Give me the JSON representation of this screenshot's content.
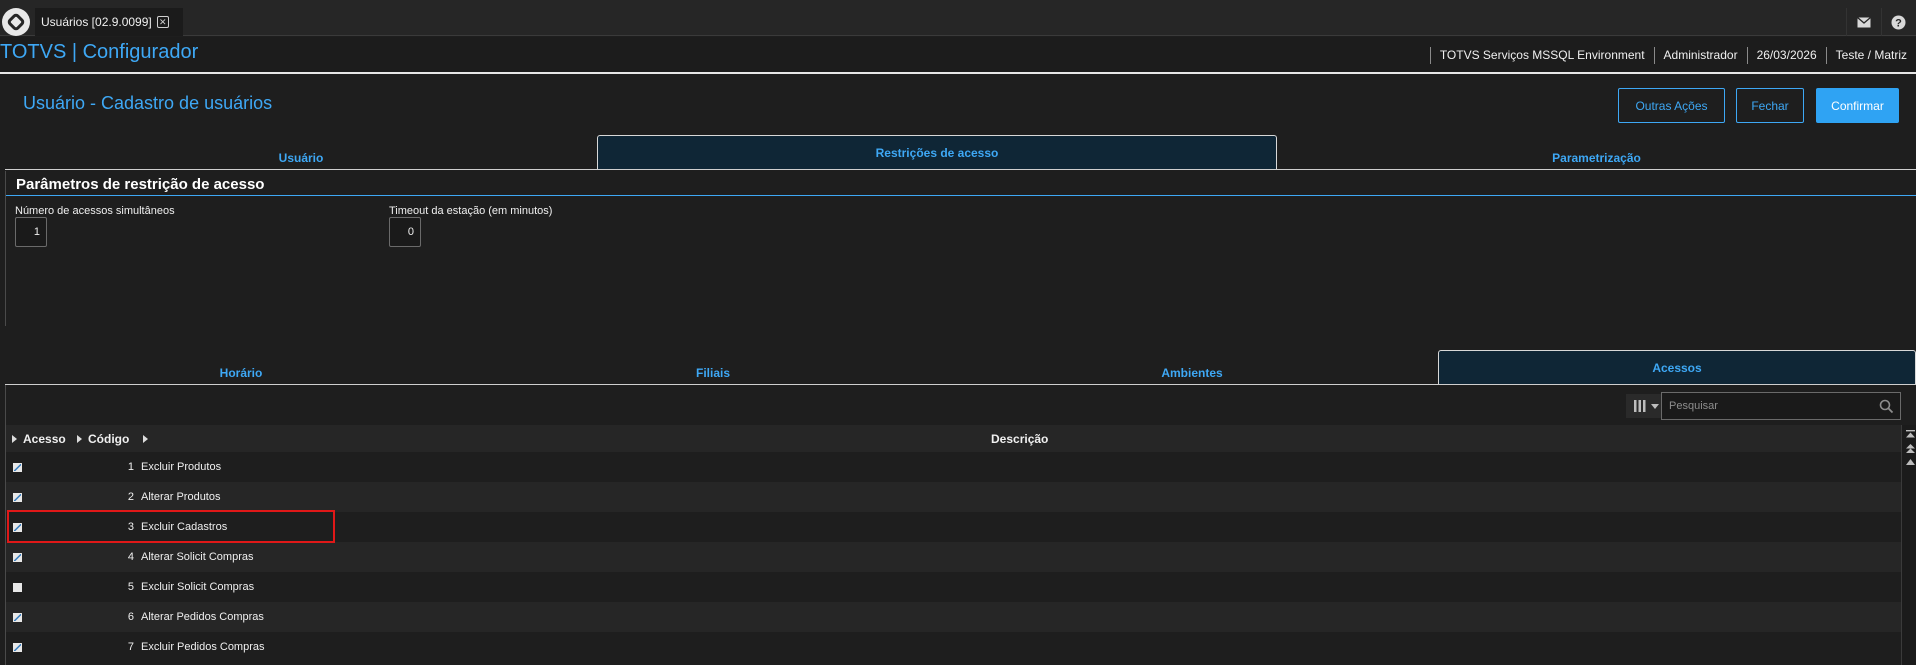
{
  "window": {
    "tab_title": "Usuários [02.9.0099]"
  },
  "top_icons": {
    "mail": "mail-icon",
    "help": "help-icon"
  },
  "app": {
    "brand": "TOTVS | Configurador",
    "environment": "TOTVS Serviços MSSQL Environment",
    "user": "Administrador",
    "date": "26/03/2026",
    "company": "Teste / Matriz"
  },
  "page": {
    "title": "Usuário - Cadastro de usuários",
    "buttons": {
      "other_actions": "Outras Ações",
      "close": "Fechar",
      "confirm": "Confirmar"
    }
  },
  "main_tabs": [
    {
      "label": "Usuário",
      "active": false
    },
    {
      "label": "Restrições de acesso",
      "active": true
    },
    {
      "label": "Parametrização",
      "active": false
    }
  ],
  "section": {
    "title": "Parâmetros de restrição de acesso",
    "fields": [
      {
        "label": "Número de acessos simultâneos",
        "value": "1"
      },
      {
        "label": "Timeout da estação (em minutos)",
        "value": "0"
      }
    ]
  },
  "sub_tabs": [
    {
      "label": "Horário",
      "active": false
    },
    {
      "label": "Filiais",
      "active": false
    },
    {
      "label": "Ambientes",
      "active": false
    },
    {
      "label": "Acessos",
      "active": true
    }
  ],
  "grid": {
    "search_placeholder": "Pesquisar",
    "columns": {
      "access": "Acesso",
      "code": "Código",
      "description": "Descrição"
    },
    "rows": [
      {
        "checked": true,
        "code": "1",
        "description": "Excluir Produtos"
      },
      {
        "checked": true,
        "code": "2",
        "description": "Alterar Produtos"
      },
      {
        "checked": true,
        "code": "3",
        "description": "Excluir Cadastros",
        "highlighted": true
      },
      {
        "checked": true,
        "code": "4",
        "description": "Alterar Solicit Compras"
      },
      {
        "checked": false,
        "code": "5",
        "description": "Excluir Solicit Compras"
      },
      {
        "checked": true,
        "code": "6",
        "description": "Alterar Pedidos Compras"
      },
      {
        "checked": true,
        "code": "7",
        "description": "Excluir Pedidos Compras"
      }
    ]
  },
  "colors": {
    "accent": "#3ea8f5",
    "background": "#1e1e1e",
    "highlight": "#e01818"
  }
}
